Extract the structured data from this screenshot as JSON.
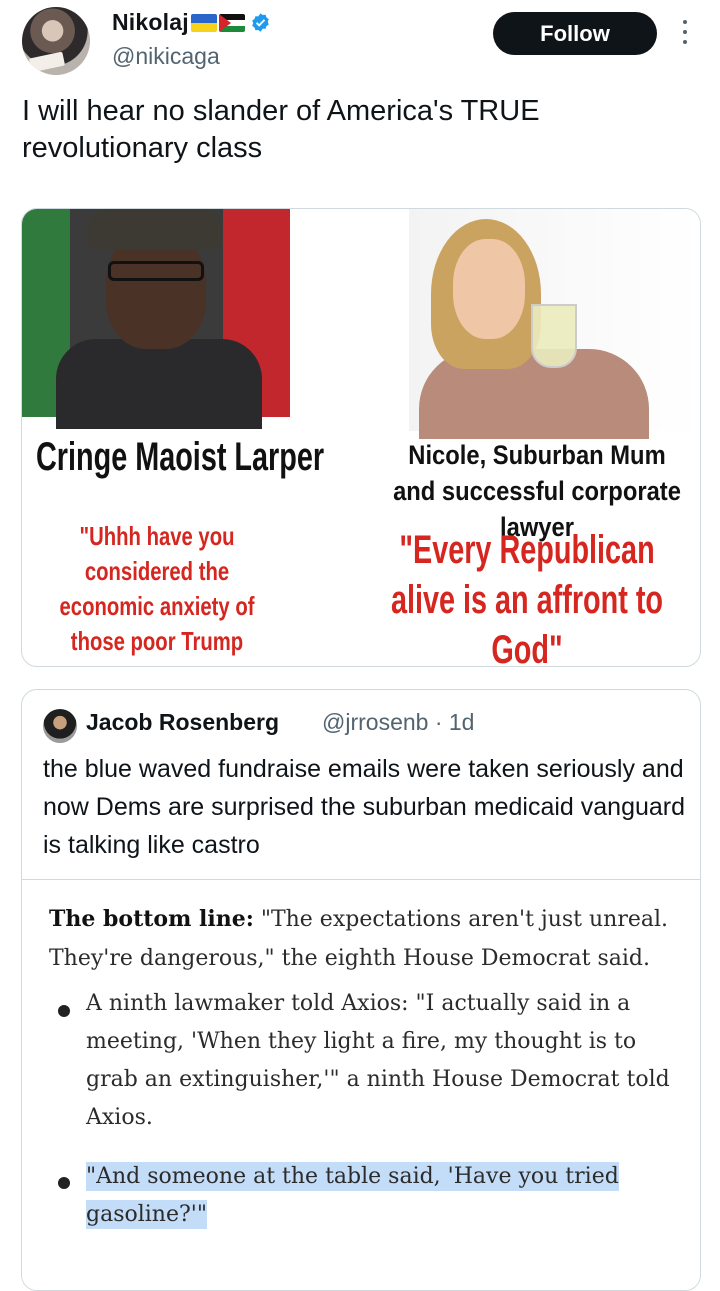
{
  "author": {
    "display_name": "Nikolaj",
    "handle": "@nikicaga",
    "flag_icons": [
      "ukraine-flag-icon",
      "palestine-flag-icon"
    ],
    "verified_icon": "verified-badge-icon"
  },
  "actions": {
    "follow_label": "Follow",
    "more_icon": "more-options-icon"
  },
  "tweet": {
    "text": "I will hear no slander of America's TRUE revolutionary class"
  },
  "meme": {
    "left": {
      "title": "Cringe Maoist Larper",
      "quote": "\"Uhhh have you considered the economic anxiety of those poor Trump voters?\""
    },
    "right": {
      "title": "Nicole, Suburban Mum and successful corporate lawyer",
      "quote": "\"Every Republican alive is an affront to God\""
    }
  },
  "quoted_tweet": {
    "name": "Jacob Rosenberg",
    "meta": "@jrrosenb · 1d",
    "text": "the blue waved fundraise emails were taken seriously and now Dems are surprised the suburban medicaid vanguard is talking like castro",
    "article": {
      "bottom_line_label": "The bottom line:",
      "bottom_line_text": " \"The expectations aren't just unreal. They're dangerous,\" the eighth House Democrat said.",
      "bullet1": "A ninth lawmaker told Axios: \"I actually said in a meeting, 'When they light a fire, my thought is to grab an extinguisher,'\" a ninth House Democrat told Axios.",
      "bullet2": "\"And someone at the table said, 'Have you tried gasoline?'\""
    }
  },
  "colors": {
    "text": "#0f1419",
    "secondary": "#536471",
    "border": "#cfd9de",
    "verified": "#1d9bf0",
    "meme_red": "#d5261f",
    "highlight": "#c3dcf7"
  }
}
